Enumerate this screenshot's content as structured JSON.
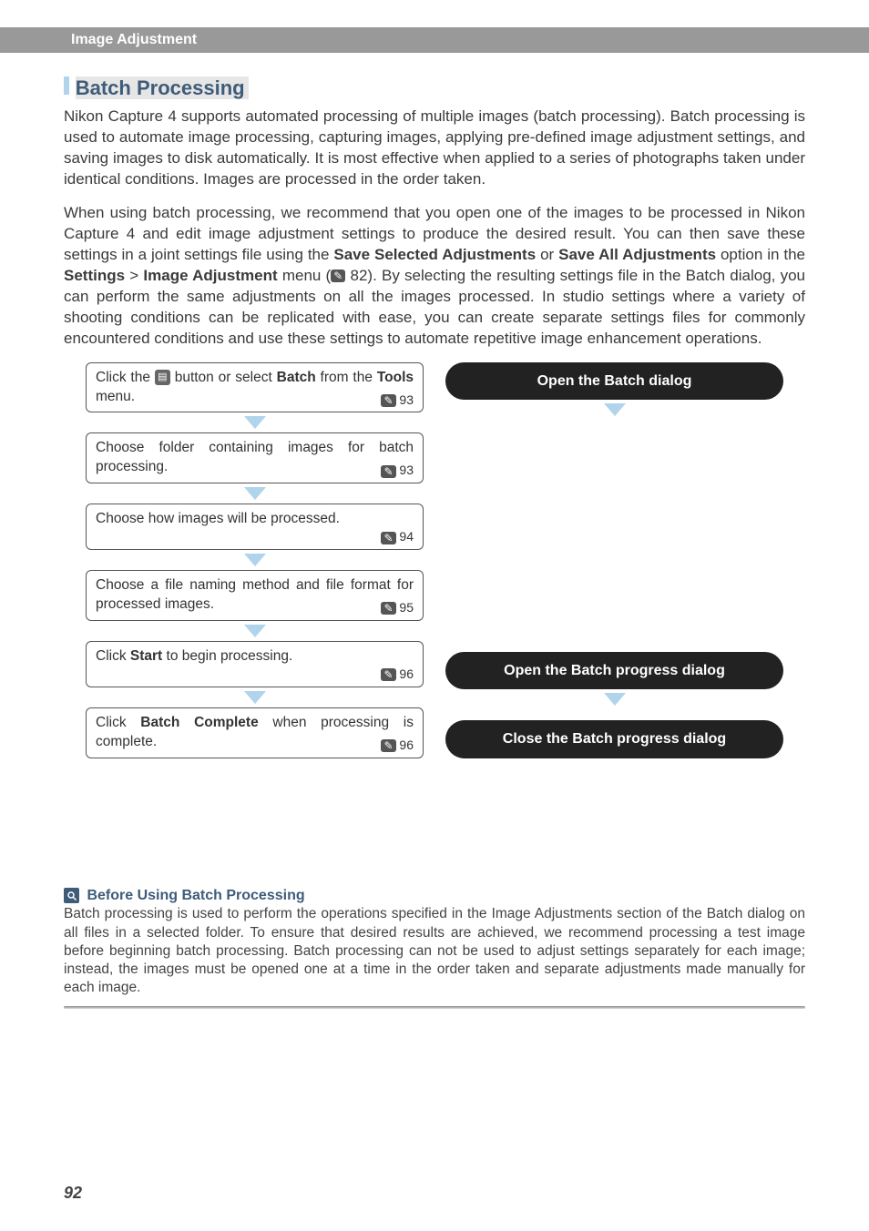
{
  "header": {
    "breadcrumb": "Image Adjustment"
  },
  "section": {
    "title": "Batch Processing",
    "para1": "Nikon Capture 4 supports automated processing of multiple images (batch processing). Batch processing is used to automate image processing, capturing images, applying pre-defined image adjustment settings, and saving images to disk automatically. It is most effective when applied to a series of photographs taken under identical conditions. Images are processed in the order taken.",
    "para2_pre": "When using batch processing, we recommend that you open one of the images to be processed in Nikon Capture 4 and edit image adjustment settings to produce the desired result. You can then save these settings in a joint settings file using the ",
    "save_selected": "Save Selected Adjustments",
    "or": " or ",
    "save_all": "Save All Adjustments",
    "option_in": " option in the ",
    "settings": "Settings",
    "gt": " > ",
    "image_adj": "Image Adjustment",
    "menu_open": " menu (",
    "ref_82": " 82",
    "para2_post": "). By selecting the resulting settings file in the Batch dialog, you can perform the same adjustments on all the images processed. In studio settings where a variety of shooting conditions can be replicated with ease, you can create separate settings files for commonly encountered conditions and use these settings to automate repetitive image enhancement operations."
  },
  "steps": [
    {
      "pre": "Click the ",
      "mid": " button or select ",
      "bold1": "Batch",
      "post": " from the ",
      "bold2": "Tools",
      "post2": " menu.",
      "ref": " 93"
    },
    {
      "text": "Choose folder containing images for batch processing.",
      "ref": " 93"
    },
    {
      "text": "Choose how images will be processed.",
      "ref": " 94"
    },
    {
      "text": "Choose a file naming method and file format for processed images.",
      "ref": " 95"
    },
    {
      "pre": "Click ",
      "bold1": "Start",
      "post": " to begin processing.",
      "ref": " 96"
    },
    {
      "pre": "Click ",
      "bold1": "Batch Complete",
      "post": " when processing is complete.",
      "ref": " 96"
    }
  ],
  "pills": {
    "open_dialog": "Open the Batch dialog",
    "open_progress": "Open the Batch progress dialog",
    "close_progress": "Close the Batch progress dialog"
  },
  "note": {
    "title": " Before Using Batch Processing",
    "body": "Batch processing is used to perform the operations specified in the Image Adjustments section of the Batch dialog on all files in a selected folder. To ensure that desired results are achieved, we recommend processing a test image before beginning batch processing. Batch processing can not be used to adjust settings separately for each image; instead, the images must be opened one at a time in the order taken and separate adjustments made manually for each image."
  },
  "page_number": "92",
  "icons": {
    "page_ref_glyph": "✎",
    "batch_btn_glyph": "▤"
  }
}
